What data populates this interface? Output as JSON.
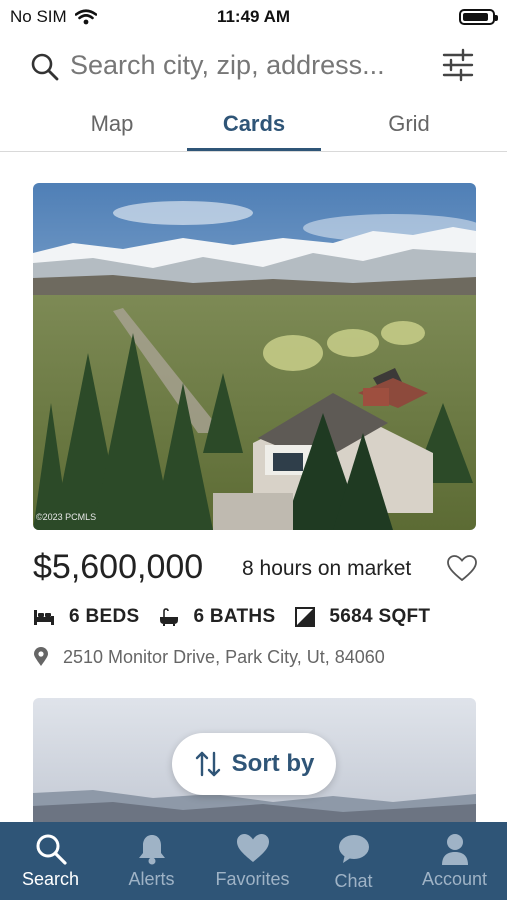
{
  "status_bar": {
    "carrier": "No SIM",
    "time": "11:49 AM",
    "battery_level": 0.9
  },
  "search": {
    "placeholder": "Search city, zip, address..."
  },
  "tabs": [
    {
      "label": "Map",
      "active": false
    },
    {
      "label": "Cards",
      "active": true
    },
    {
      "label": "Grid",
      "active": false
    }
  ],
  "listing": {
    "photo_credit": "©2023 PCMLS",
    "price": "$5,600,000",
    "time_on_market": "8 hours on market",
    "beds": "6 BEDS",
    "baths": "6 BATHS",
    "sqft": "5684 SQFT",
    "address": "2510 Monitor Drive, Park City, Ut, 84060"
  },
  "sort": {
    "label": "Sort by"
  },
  "nav": [
    {
      "label": "Search",
      "icon": "search-icon",
      "active": true
    },
    {
      "label": "Alerts",
      "icon": "bell-icon",
      "active": false
    },
    {
      "label": "Favorites",
      "icon": "heart-icon",
      "active": false
    },
    {
      "label": "Chat",
      "icon": "chat-icon",
      "active": false
    },
    {
      "label": "Account",
      "icon": "person-icon",
      "active": false
    }
  ],
  "colors": {
    "brand": "#2f5577",
    "nav_inactive": "#9fb3c6"
  }
}
